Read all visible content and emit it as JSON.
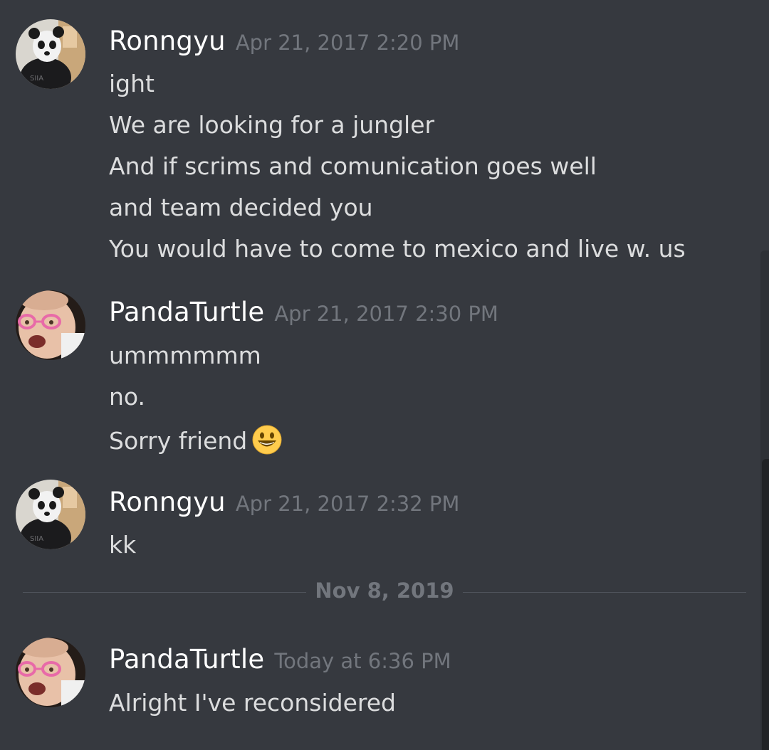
{
  "colors": {
    "background": "#36393f",
    "username": "#ffffff",
    "timestamp": "#72767d",
    "message_text": "#dcddde",
    "divider": "#4f545c"
  },
  "messages": [
    {
      "username": "Ronngyu",
      "timestamp": "Apr 21, 2017 2:20 PM",
      "avatar_icon": "panda-mask-avatar-icon",
      "lines": [
        "ight",
        "We are looking for a jungler",
        "And if scrims and comunication goes well",
        "and team decided you",
        "You would have to come to mexico and live w. us"
      ]
    },
    {
      "username": "PandaTurtle",
      "timestamp": "Apr 21, 2017 2:30 PM",
      "avatar_icon": "baby-glasses-avatar-icon",
      "lines": [
        "ummmmmm",
        "no.",
        "Sorry friend"
      ],
      "emoji": "smiley-emoji-icon"
    },
    {
      "username": "Ronngyu",
      "timestamp": "Apr 21, 2017 2:32 PM",
      "avatar_icon": "panda-mask-avatar-icon",
      "lines": [
        "kk"
      ]
    },
    {
      "username": "PandaTurtle",
      "timestamp": "Today at 6:36 PM",
      "avatar_icon": "baby-glasses-avatar-icon",
      "lines": [
        "Alright I've reconsidered"
      ]
    }
  ],
  "date_divider": "Nov 8, 2019"
}
